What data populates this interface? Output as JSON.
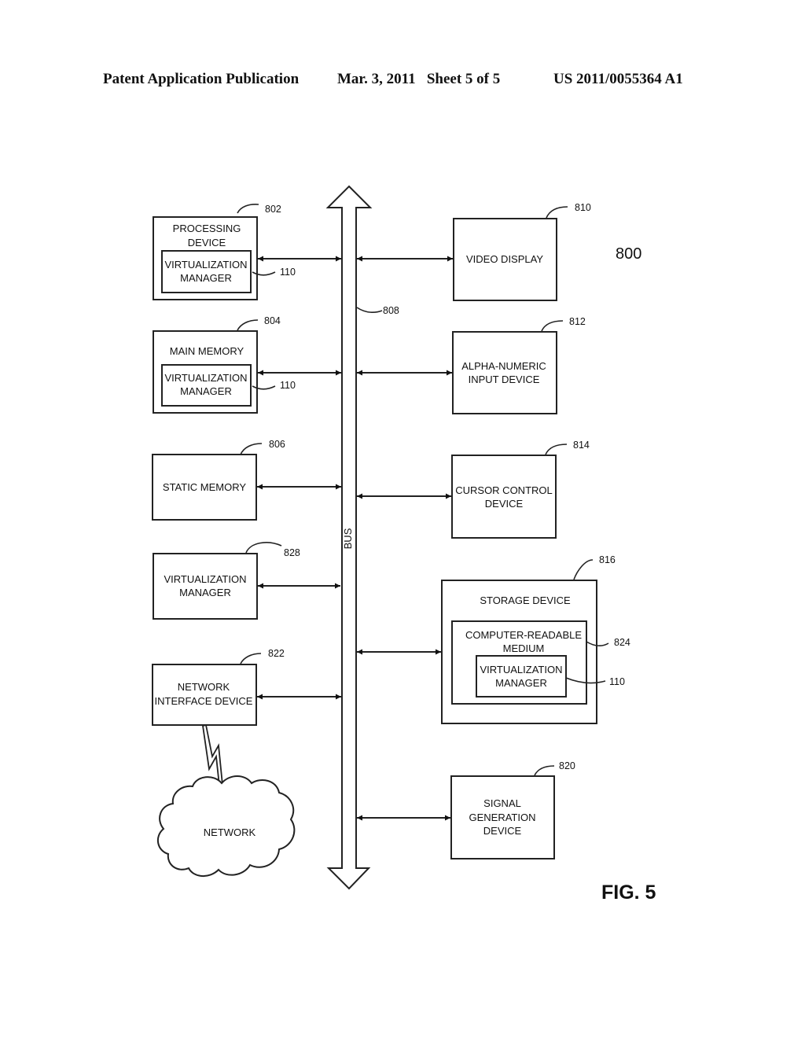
{
  "header": {
    "publication": "Patent Application Publication",
    "date_sheet": "Mar. 3, 2011   Sheet 5 of 5",
    "number": "US 2011/0055364 A1"
  },
  "figure": {
    "ref": "800",
    "caption": "FIG. 5",
    "bus": {
      "label": "BUS",
      "ref": "808"
    },
    "left_blocks": [
      {
        "id": "processing-device",
        "ref": "802",
        "lines": [
          "PROCESSING",
          "DEVICE"
        ],
        "inner": {
          "ref": "110",
          "lines": [
            "VIRTUALIZATION",
            "MANAGER"
          ]
        }
      },
      {
        "id": "main-memory",
        "ref": "804",
        "lines": [
          "MAIN MEMORY"
        ],
        "inner": {
          "ref": "110",
          "lines": [
            "VIRTUALIZATION",
            "MANAGER"
          ]
        }
      },
      {
        "id": "static-memory",
        "ref": "806",
        "lines": [
          "STATIC MEMORY"
        ]
      },
      {
        "id": "virtualization-manager",
        "ref": "828",
        "lines": [
          "VIRTUALIZATION",
          "MANAGER"
        ]
      },
      {
        "id": "network-interface-device",
        "ref": "822",
        "lines": [
          "NETWORK",
          "INTERFACE DEVICE"
        ]
      }
    ],
    "right_blocks": [
      {
        "id": "video-display",
        "ref": "810",
        "lines": [
          "VIDEO DISPLAY"
        ]
      },
      {
        "id": "alpha-numeric-input-device",
        "ref": "812",
        "lines": [
          "ALPHA-NUMERIC",
          "INPUT DEVICE"
        ]
      },
      {
        "id": "cursor-control-device",
        "ref": "814",
        "lines": [
          "CURSOR CONTROL",
          "DEVICE"
        ]
      },
      {
        "id": "storage-device",
        "ref": "816",
        "lines": [
          "STORAGE DEVICE"
        ],
        "medium": {
          "ref": "824",
          "lines": [
            "COMPUTER-READABLE",
            "MEDIUM"
          ],
          "inner": {
            "ref": "110",
            "lines": [
              "VIRTUALIZATION",
              "MANAGER"
            ]
          }
        }
      },
      {
        "id": "signal-generation-device",
        "ref": "820",
        "lines": [
          "SIGNAL",
          "GENERATION",
          "DEVICE"
        ]
      }
    ],
    "network": {
      "label": "NETWORK"
    }
  }
}
